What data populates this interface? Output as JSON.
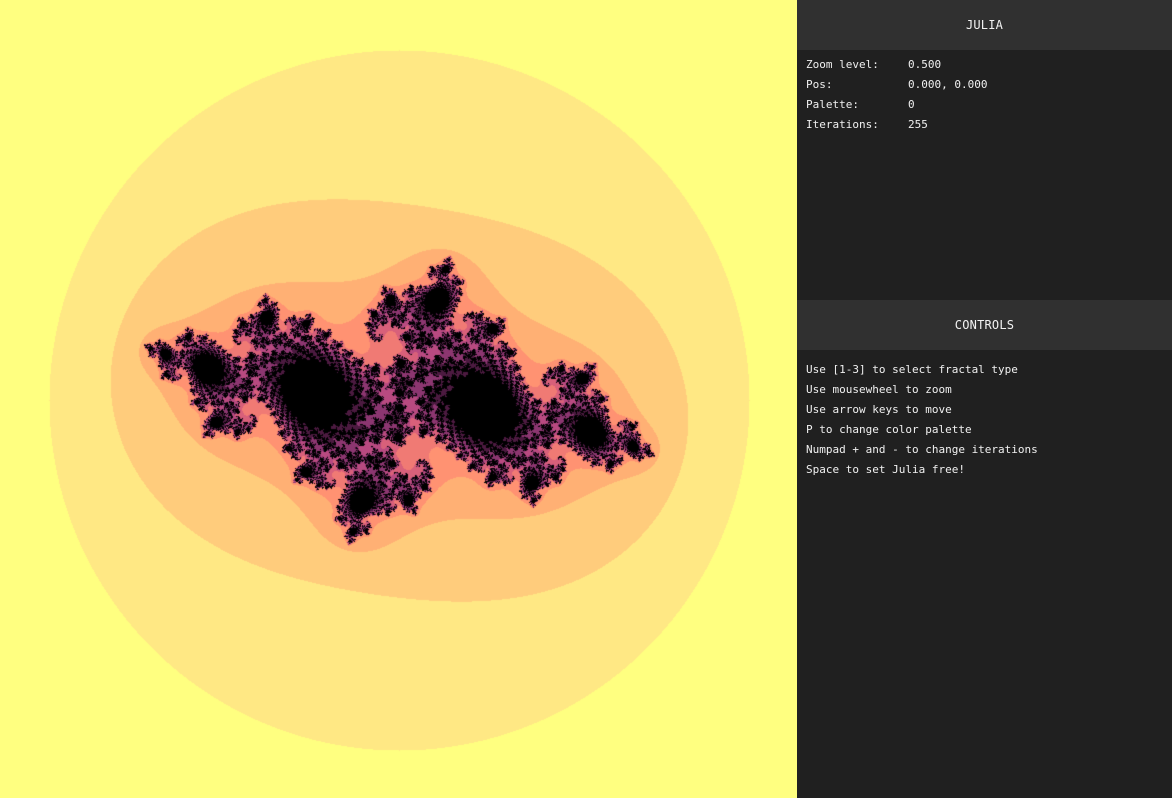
{
  "colors": {
    "background": "#ffff80",
    "panel_bg": "#202020",
    "header_bg": "#303030",
    "fractal_interior": "#000000",
    "palette": [
      "#ffff80",
      "#ffe884",
      "#ffcc7c",
      "#ffb074",
      "#ff9272",
      "#f07a74",
      "#d8607a",
      "#b84a80",
      "#8c3670",
      "#4c1a40"
    ]
  },
  "fractal": {
    "type": "julia",
    "zoom": 0.5,
    "pos": [
      0.0,
      0.0
    ],
    "palette_index": 0,
    "iterations": 255
  },
  "info": {
    "title": "JULIA",
    "rows": [
      {
        "label": "Zoom level:",
        "value": "0.500"
      },
      {
        "label": "Pos:",
        "value": "0.000, 0.000"
      },
      {
        "label": "Palette:",
        "value": "0"
      },
      {
        "label": "Iterations:",
        "value": "255"
      }
    ]
  },
  "controls": {
    "title": "CONTROLS",
    "items": [
      "Use [1-3] to select fractal type",
      "Use mousewheel to zoom",
      "Use arrow keys to move",
      "P to change color palette",
      "Numpad + and - to change iterations",
      "Space to set Julia free!"
    ]
  }
}
